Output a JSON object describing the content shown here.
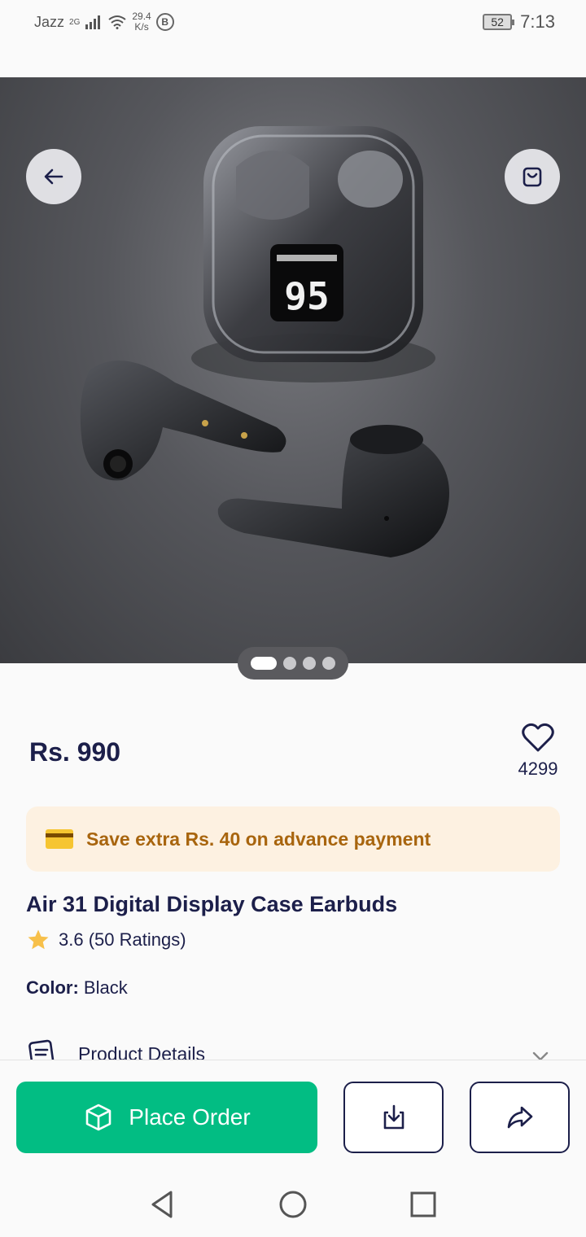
{
  "status_bar": {
    "carrier": "Jazz",
    "network": "2G",
    "speed_value": "29.4",
    "speed_unit": "K/s",
    "b_badge": "B",
    "battery": "52",
    "time": "7:13"
  },
  "gallery": {
    "total_images": 4,
    "active_index": 0,
    "display_number": "95"
  },
  "product": {
    "price": "Rs. 990",
    "wishlist_count": "4299",
    "promo_text": "Save extra Rs. 40 on advance payment",
    "title": "Air 31 Digital Display Case Earbuds",
    "rating_text": "3.6 (50 Ratings)",
    "color_label": "Color:",
    "color_value": "Black",
    "details_label": "Product Details"
  },
  "actions": {
    "place_order_label": "Place Order"
  },
  "colors": {
    "primary_green": "#02bd83",
    "navy": "#1c1f4a",
    "promo_bg": "#fdf1e1",
    "promo_text": "#a8650e",
    "star": "#f7c04a"
  },
  "icons": {
    "back": "arrow-left-icon",
    "cart": "shopping-bag-icon",
    "wishlist": "heart-icon",
    "promo": "credit-card-icon",
    "rating": "star-icon",
    "details": "document-icon",
    "expand": "chevron-down-icon",
    "place_order": "box-icon",
    "download": "download-icon",
    "share": "share-icon"
  }
}
